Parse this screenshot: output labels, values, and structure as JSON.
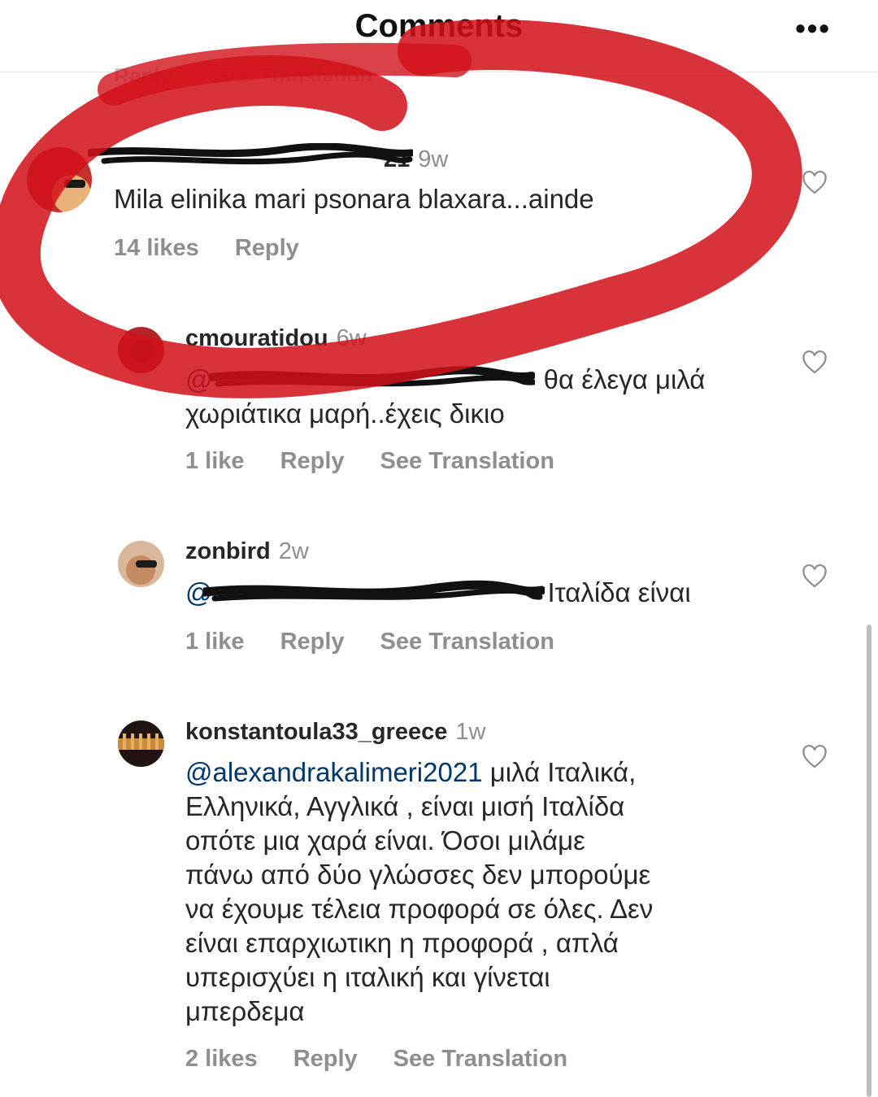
{
  "header": {
    "title": "Comments",
    "more_label": "•••"
  },
  "ghost_row": {
    "reply": "Reply",
    "translate": "See Translation"
  },
  "comments": [
    {
      "username_visible": "21",
      "time": "9w",
      "text": "Mila elinika mari psonara blaxara...ainde",
      "likes": "14 likes",
      "reply": "Reply"
    },
    {
      "username": "cmouratidou",
      "time": "6w",
      "mention": "@",
      "text_line1": " θα έλεγα μιλά",
      "text_line2": "χωριάτικα μαρή..έχεις δικιο",
      "likes": "1 like",
      "reply": "Reply",
      "translate": "See Translation"
    },
    {
      "username": "zonbird",
      "time": "2w",
      "mention": "@",
      "text": "Ιταλίδα είναι",
      "likes": "1 like",
      "reply": "Reply",
      "translate": "See Translation"
    },
    {
      "username": "konstantoula33_greece",
      "time": "1w",
      "mention": "@alexandrakalimeri2021",
      "text_lines": [
        " μιλά Ιταλικά,",
        "Ελληνικά, Αγγλικά , είναι μισή Ιταλίδα",
        "οπότε μια χαρά  είναι. Όσοι μιλάμε",
        "πάνω από δύο γλώσσες  δεν μπορούμε",
        "να έχουμε τέλεια προφορά σε όλες. Δεν",
        "είναι επαρχιωτικη η προφορά , απλά",
        "υπερισχύει η ιταλική και γίνεται",
        "μπερδεμα"
      ],
      "likes": "2 likes",
      "reply": "Reply",
      "translate": "See Translation"
    }
  ],
  "colors": {
    "mention": "#00376b",
    "secondary": "#8e8e8e",
    "marker_red": "#d2121a"
  }
}
